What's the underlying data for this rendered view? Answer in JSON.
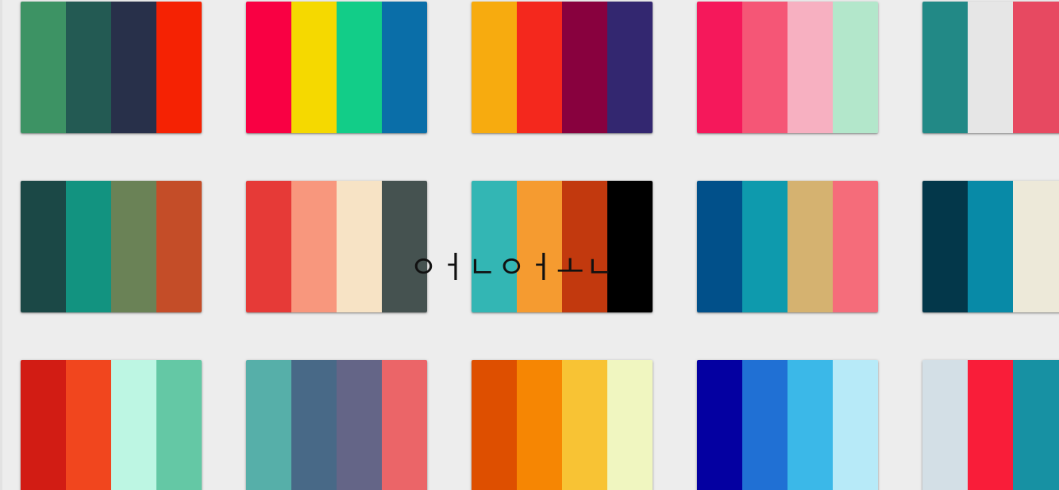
{
  "overlay_text": "ㅇㅓㄴㅇㅓㅗㄴ",
  "rows": [
    [
      {
        "name": "palette-1-1",
        "colors": [
          "#3d9364",
          "#235a53",
          "#28304a",
          "#f52203"
        ]
      },
      {
        "name": "palette-1-2",
        "colors": [
          "#f90043",
          "#f5d900",
          "#12cd88",
          "#0a6ea8"
        ]
      },
      {
        "name": "palette-1-3",
        "colors": [
          "#f7ab0f",
          "#f4281d",
          "#88013e",
          "#332770"
        ]
      },
      {
        "name": "palette-1-4",
        "colors": [
          "#f5185b",
          "#f55676",
          "#f7b0c1",
          "#b3e7cb"
        ]
      },
      {
        "name": "palette-1-5",
        "colors": [
          "#228986",
          "#e6e6e6",
          "#e74961",
          "#e74961"
        ]
      }
    ],
    [
      {
        "name": "palette-2-1",
        "colors": [
          "#1b4846",
          "#129380",
          "#6a8256",
          "#c44d28"
        ]
      },
      {
        "name": "palette-2-2",
        "colors": [
          "#e63a37",
          "#f8977d",
          "#f7e3c5",
          "#455250"
        ]
      },
      {
        "name": "palette-2-3",
        "colors": [
          "#33b6b4",
          "#f59b30",
          "#c2390e",
          "#000000"
        ]
      },
      {
        "name": "palette-2-4",
        "colors": [
          "#01508a",
          "#0e9aad",
          "#d5b270",
          "#f56c7a"
        ]
      },
      {
        "name": "palette-2-5",
        "colors": [
          "#03374a",
          "#088aa7",
          "#ede9d9",
          "#ede9d9"
        ]
      }
    ],
    [
      {
        "name": "palette-3-1",
        "colors": [
          "#d21c14",
          "#f1461e",
          "#bdf6e3",
          "#64c8a5"
        ]
      },
      {
        "name": "palette-3-2",
        "colors": [
          "#56afa9",
          "#486987",
          "#646587",
          "#eb6568"
        ]
      },
      {
        "name": "palette-3-3",
        "colors": [
          "#de4f00",
          "#f68603",
          "#f8c334",
          "#f0f6c0"
        ]
      },
      {
        "name": "palette-3-4",
        "colors": [
          "#0400a1",
          "#2070d4",
          "#3bb8e8",
          "#b7eaf8"
        ]
      },
      {
        "name": "palette-3-5",
        "colors": [
          "#d3dfe6",
          "#f91d39",
          "#1791a3",
          "#1791a3"
        ]
      }
    ]
  ]
}
